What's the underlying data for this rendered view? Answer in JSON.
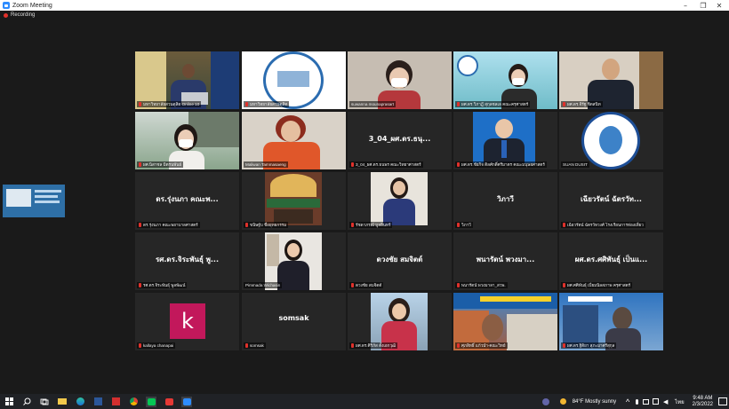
{
  "window": {
    "title": "Zoom Meeting",
    "controls": [
      "–",
      "❐",
      "✕"
    ]
  },
  "recording": {
    "label": "Recording"
  },
  "tiles": [
    {
      "label": "มหาวิทยาลัยสวนดุสิต Online 10"
    },
    {
      "label": "มหาวิทยาลัยสวนดุสิต"
    },
    {
      "label": "suwanna mounaprasart"
    },
    {
      "label": "ผศ.ดร.วิภาฎี สุกุลชลเล คณะครุศาสตร์"
    },
    {
      "label": "ผศ.ดร.จีรัฐ ชิดสนิท"
    },
    {
      "label": "ผศ.นิสาชล มิตรนพันธ์"
    },
    {
      "label": "Maliwan Tammasaeng"
    },
    {
      "center": "3_04_ผศ.ดร.ธนุ...",
      "label": "3_04_ผศ.ดร.ธนพร คณะวิทยาศาสตร์"
    },
    {
      "label": "ผศ.ดร.ชัยกิจ ติลศักดิ์ศรีมาตร คณะมนุษยศาสตร์"
    },
    {
      "label": "SUAN DUSIT"
    },
    {
      "center": "ดร.รุ่งนภา คณะพ...",
      "label": "ดร.รุ่งนภา คณะพยาบาลศาสตร์"
    },
    {
      "label": "ขนิษฐ์บ ชื่อยุทธกรรม"
    },
    {
      "label": "รัชดาภรณ์ มูลอินทร์"
    },
    {
      "center": "วิภาวี",
      "label": "วิภาวี"
    },
    {
      "center": "เฉียวรัตน์ ฉัตรวัท...",
      "label": "เฉียวรัตน์ ฉัตรวัทวงศ์ โรงเรียนการท่องเที่ยว"
    },
    {
      "center": "รศ.ดร.จิระพันธุ์ พู...",
      "label": "รศ.ดร.จิระพันธุ์ พูลพัฒน์"
    },
    {
      "label": "Pimmada Wichasin"
    },
    {
      "center": "ดวงชัย สมจิตต์",
      "label": "ดวงชัย สมจิตต์"
    },
    {
      "center": "พนารัตน์ พวงมา...",
      "label": "พนารัตน์ พวงมาลา_สวพ."
    },
    {
      "center": "ผศ.ดร.ศศิพันธุ์ เป็นแ...",
      "label": "ผศ.ศศิพันธุ์ เปี่ยมนิลสภาพ ครุศาสตร์"
    },
    {
      "avatar": "k",
      "label": "kallaya chanapai"
    },
    {
      "center": "somsak",
      "label": "somsak"
    },
    {
      "label": "ผศ.ดร.ศิริภัส ตั้งเอกวุฒิ"
    },
    {
      "label": "ศุภสิทธิ์ แก้วนำ-คณะวิทย์"
    },
    {
      "label": "ผศ.ดร.ฐิติยา สุภะมาศรีสุกุล"
    }
  ],
  "taskbar": {
    "weather": "84°F  Mostly sunny",
    "lang": "ไทย",
    "time": "9:48 AM",
    "date": "2/3/2022"
  }
}
